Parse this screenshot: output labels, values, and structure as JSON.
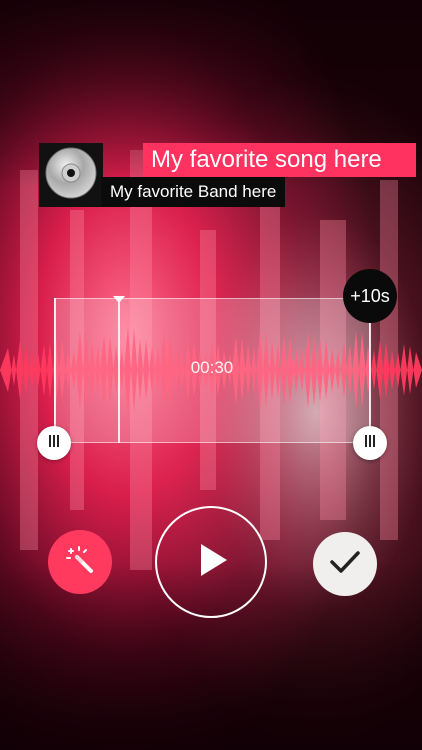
{
  "song": {
    "title": "My favorite song here",
    "band": "My favorite Band here"
  },
  "editor": {
    "time_display": "00:30",
    "extend_label": "+10s"
  },
  "icons": {
    "cover": "cd-disc-icon",
    "handle": "grip-lines-icon",
    "magic": "magic-wand-icon",
    "play": "play-icon",
    "done": "checkmark-icon"
  },
  "colors": {
    "accent": "#ff3260",
    "background": "#2a0410",
    "dark": "#0b0b0b"
  }
}
